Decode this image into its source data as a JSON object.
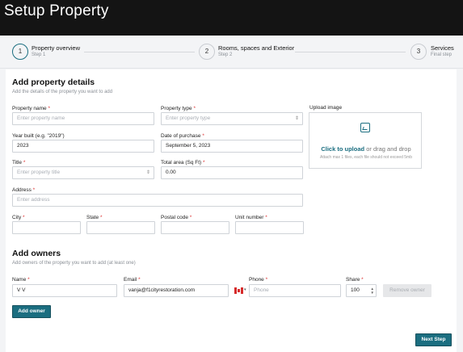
{
  "header": {
    "title": "Setup Property"
  },
  "stepper": {
    "steps": [
      {
        "number": "1",
        "title": "Property overview",
        "subtitle": "Step 1"
      },
      {
        "number": "2",
        "title": "Rooms, spaces and Exterior",
        "subtitle": "Step 2"
      },
      {
        "number": "3",
        "title": "Services",
        "subtitle": "Final step"
      }
    ]
  },
  "details": {
    "title": "Add property details",
    "subtitle": "Add the details of the property you want to add",
    "property_name": {
      "label": "Property name",
      "placeholder": "Enter property name",
      "value": ""
    },
    "property_type": {
      "label": "Property type",
      "placeholder": "Enter property type",
      "value": ""
    },
    "year_built": {
      "label": "Year built (e.g. \"2019\")",
      "value": "2023"
    },
    "date_of_purchase": {
      "label": "Date of purchase",
      "value": "September 5, 2023"
    },
    "title_field": {
      "label": "Title",
      "placeholder": "Enter property title",
      "value": ""
    },
    "total_area": {
      "label": "Total area (Sq Ft)",
      "value": "0.00"
    },
    "address": {
      "label": "Address",
      "placeholder": "Enter address",
      "value": ""
    },
    "city": {
      "label": "City",
      "value": ""
    },
    "state": {
      "label": "State",
      "value": ""
    },
    "postal_code": {
      "label": "Postal code",
      "value": ""
    },
    "unit_number": {
      "label": "Unit number",
      "value": ""
    },
    "required_mark": "*"
  },
  "upload": {
    "label": "Upload image",
    "link_text": "Click to upload",
    "rest_text": "or drag and drop",
    "hint": "Attach max 1 files, each file should not exceed 5mb"
  },
  "owners": {
    "title": "Add owners",
    "subtitle": "Add owners of the property you want to add (at least one)",
    "name": {
      "label": "Name",
      "value": "V V"
    },
    "email": {
      "label": "Email",
      "value": "vanja@f1cityrestoration.com"
    },
    "phone": {
      "label": "Phone",
      "placeholder": "Phone",
      "value": "",
      "country": "Canada"
    },
    "share": {
      "label": "Share",
      "value": "100"
    },
    "remove_owner_label": "Remove owner",
    "add_owner_label": "Add owner"
  },
  "footer": {
    "next_label": "Next Step"
  },
  "colors": {
    "accent": "#1b6e80",
    "header_bg": "#141414",
    "required": "#dd3333"
  }
}
